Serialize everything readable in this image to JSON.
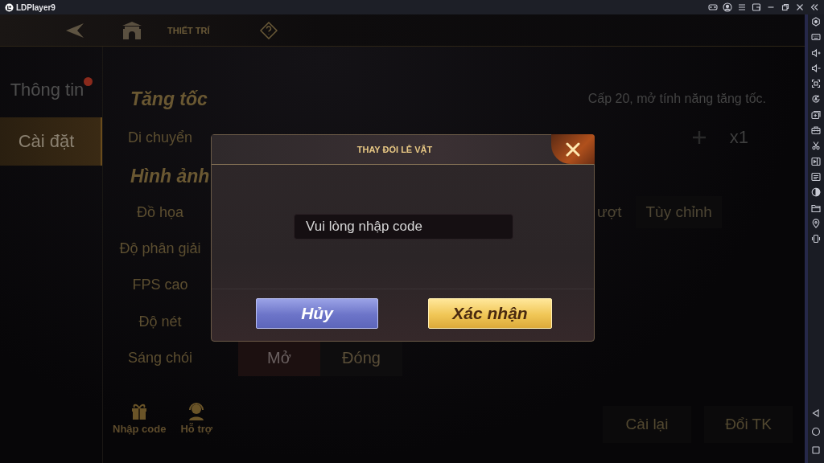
{
  "window": {
    "title": "LDPlayer9"
  },
  "game": {
    "header": {
      "title": "THIẾT TRÍ"
    },
    "tabs": [
      {
        "label": "Thông tin",
        "selected": false,
        "badge": true
      },
      {
        "label": "Cài đặt",
        "selected": true,
        "badge": false
      }
    ],
    "settings_rows": [
      {
        "kind": "heading",
        "label": "Tăng tốc"
      },
      {
        "kind": "label",
        "label": "Di chuyển"
      },
      {
        "kind": "heading",
        "label": "Hình ảnh"
      },
      {
        "kind": "label",
        "label": "Đồ họa"
      },
      {
        "kind": "label",
        "label": "Độ phân giải"
      },
      {
        "kind": "label",
        "label": "FPS cao"
      },
      {
        "kind": "label",
        "label": "Độ nét"
      },
      {
        "kind": "toggle",
        "label": "Sáng chói",
        "options": [
          {
            "label": "Mở",
            "selected": true
          },
          {
            "label": "Đóng",
            "selected": false
          }
        ]
      }
    ],
    "speed_notice": "Cấp 20, mở tính năng tăng tốc.",
    "multiplier": "x1",
    "graphics_options": [
      "ượt",
      "Tùy chỉnh"
    ],
    "shortcuts": [
      {
        "kind": "gift",
        "label": "Nhập code"
      },
      {
        "kind": "support",
        "label": "Hỗ trợ"
      }
    ],
    "account_buttons": [
      "Cài lại",
      "Đổi TK"
    ]
  },
  "dialog": {
    "title": "THAY ĐỔI LỄ VẬT",
    "input": {
      "placeholder": "Vui lòng nhập code"
    },
    "buttons": [
      {
        "kind": "cancel",
        "label": "Hủy"
      },
      {
        "kind": "confirm",
        "label": "Xác nhận"
      }
    ]
  }
}
